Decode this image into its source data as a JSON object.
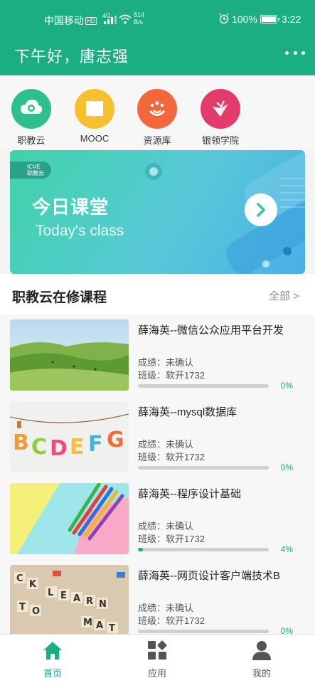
{
  "status_bar": {
    "carrier": "中国移动",
    "hd": "HD",
    "network": "4G",
    "speed_value": "514",
    "speed_unit": "B/s",
    "battery": "100%",
    "time": "3:22"
  },
  "header": {
    "greeting": "下午好，唐志强",
    "more_icon": "more-dots-icon"
  },
  "quick_apps": [
    {
      "label": "职教云",
      "icon": "cloud-icon",
      "color": "#2dc08c"
    },
    {
      "label": "MOOC",
      "icon": "book-icon",
      "color": "#f7c12d"
    },
    {
      "label": "资源库",
      "icon": "resource-icon",
      "color": "#f2683a"
    },
    {
      "label": "银领学院",
      "icon": "academy-icon",
      "color": "#e23c6b"
    }
  ],
  "banner": {
    "logo_text_1": "ICVE",
    "logo_text_2": "职教云",
    "title": "今日课堂",
    "subtitle": "Today's class"
  },
  "section": {
    "title": "职教云在修课程",
    "all_link": "全部 >"
  },
  "courses": [
    {
      "name": "薛海英--微信公众应用平台开发",
      "grade": "成绩：未确认",
      "class": "班级：软开1732",
      "progress": 0,
      "progress_label": "0%",
      "thumb": "grassland"
    },
    {
      "name": "薛海英--mysql数据库",
      "grade": "成绩：未确认",
      "class": "班级：软开1732",
      "progress": 0,
      "progress_label": "0%",
      "thumb": "letters"
    },
    {
      "name": "薛海英--程序设计基础",
      "grade": "成绩：未确认",
      "class": "班级：软开1732",
      "progress": 4,
      "progress_label": "4%",
      "thumb": "pencils"
    },
    {
      "name": "薛海英--网页设计客户端技术B",
      "grade": "成绩：未确认",
      "class": "班级：软开1732",
      "progress": 0,
      "progress_label": "0%",
      "thumb": "scrabble"
    }
  ],
  "bottom_nav": [
    {
      "label": "首页",
      "icon": "home-icon",
      "active": true
    },
    {
      "label": "应用",
      "icon": "apps-icon",
      "active": false
    },
    {
      "label": "我的",
      "icon": "profile-icon",
      "active": false
    }
  ],
  "colors": {
    "brand": "#1aae82",
    "inactive": "#555555"
  }
}
